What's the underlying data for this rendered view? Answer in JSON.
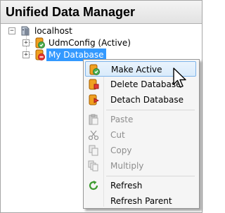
{
  "panel": {
    "title": "Unified Data Manager"
  },
  "tree": {
    "root": {
      "label": "localhost",
      "expander": "−"
    },
    "children": [
      {
        "label": "UdmConfig (Active)",
        "expander": "+"
      },
      {
        "label": "My Database",
        "expander": "+",
        "selected": true
      }
    ]
  },
  "context_menu": {
    "items": [
      {
        "label": "Make Active",
        "icon": "make-active-icon",
        "enabled": true,
        "hover": true
      },
      {
        "label": "Delete Database",
        "icon": "delete-database-icon",
        "enabled": true
      },
      {
        "label": "Detach Database",
        "icon": "detach-database-icon",
        "enabled": true
      },
      {
        "label": "Paste",
        "icon": "paste-icon",
        "enabled": false
      },
      {
        "label": "Cut",
        "icon": "cut-icon",
        "enabled": false
      },
      {
        "label": "Copy",
        "icon": "copy-icon",
        "enabled": false
      },
      {
        "label": "Multiply",
        "icon": "multiply-icon",
        "enabled": false
      },
      {
        "label": "Refresh",
        "icon": "refresh-icon",
        "enabled": true
      },
      {
        "label": "Refresh Parent",
        "icon": "",
        "enabled": true
      }
    ]
  },
  "colors": {
    "selection": "#3399ff",
    "menu_hover_border": "#7eb4ea",
    "disabled_text": "#8d8d8d"
  }
}
